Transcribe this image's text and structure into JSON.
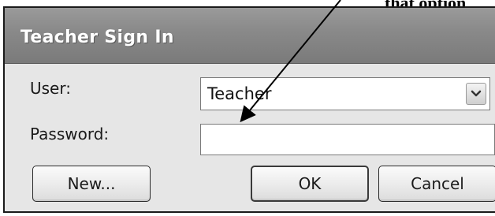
{
  "annotation": {
    "text": "that option"
  },
  "dialog": {
    "title": "Teacher Sign In",
    "user_label": "User:",
    "user_value": "Teacher",
    "password_label": "Password:",
    "password_value": "",
    "buttons": {
      "new": "New...",
      "ok": "OK",
      "cancel": "Cancel"
    }
  },
  "icons": {
    "dropdown": "chevron-down-icon",
    "arrow": "annotation-arrow"
  }
}
